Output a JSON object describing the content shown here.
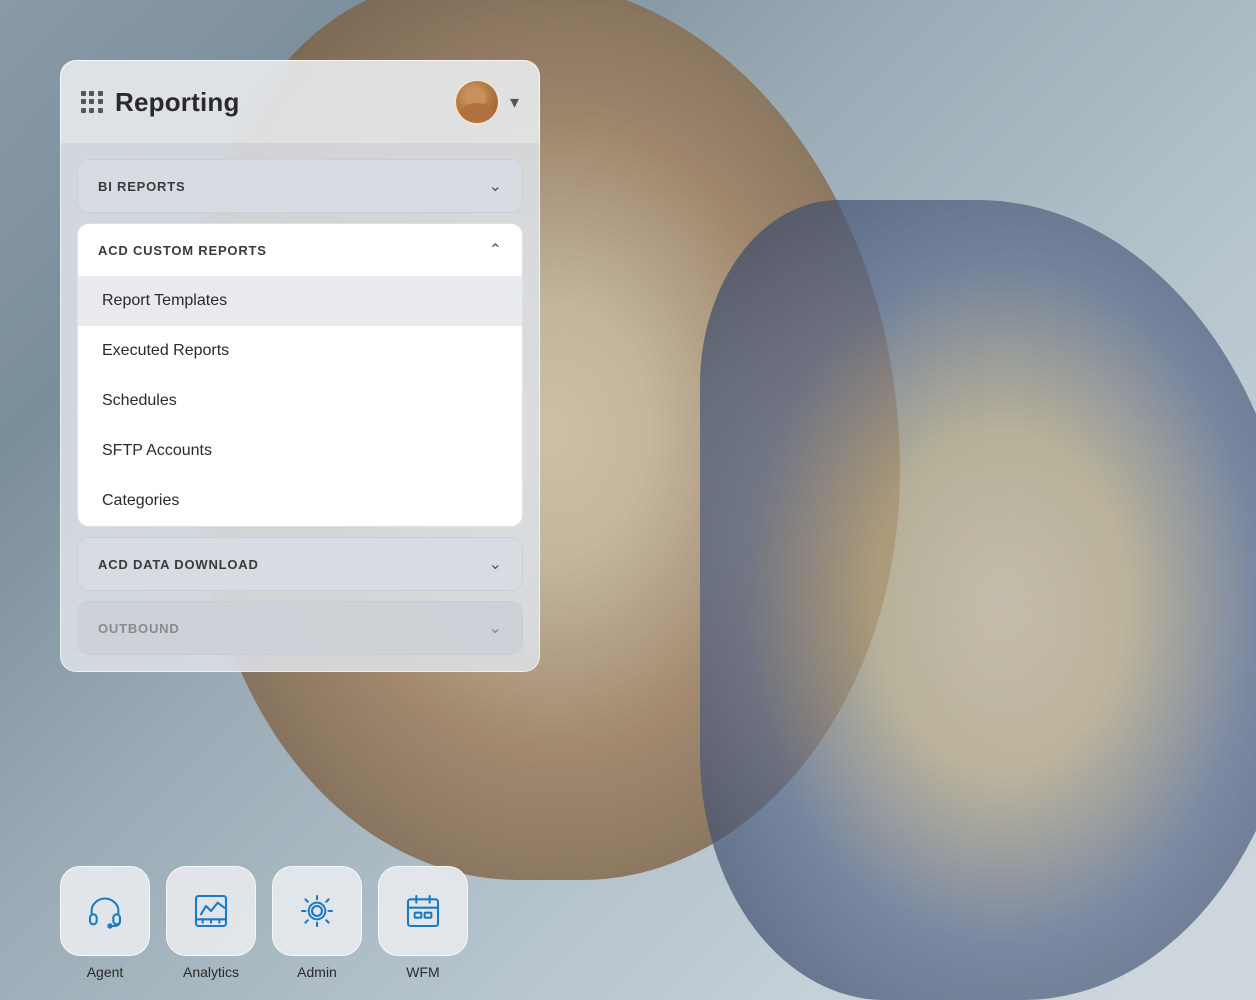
{
  "header": {
    "title": "Reporting",
    "chevron": "▾",
    "avatar_alt": "User avatar"
  },
  "menu": {
    "bi_reports": {
      "label": "BI REPORTS",
      "expanded": false,
      "chevron_collapsed": "⌄"
    },
    "acd_custom_reports": {
      "label": "ACD CUSTOM REPORTS",
      "expanded": true,
      "chevron_expanded": "⌃",
      "items": [
        {
          "label": "Report Templates",
          "active": true
        },
        {
          "label": "Executed Reports",
          "active": false
        },
        {
          "label": "Schedules",
          "active": false
        },
        {
          "label": "SFTP Accounts",
          "active": false
        },
        {
          "label": "Categories",
          "active": false
        }
      ]
    },
    "acd_data_download": {
      "label": "ACD DATA DOWNLOAD",
      "expanded": false,
      "chevron_collapsed": "⌄"
    },
    "outbound": {
      "label": "OUTBOUND",
      "expanded": false,
      "chevron_collapsed": "⌄",
      "disabled": true
    }
  },
  "bottom_nav": {
    "items": [
      {
        "id": "agent",
        "label": "Agent",
        "icon": "headset-icon"
      },
      {
        "id": "analytics",
        "label": "Analytics",
        "icon": "analytics-icon"
      },
      {
        "id": "admin",
        "label": "Admin",
        "icon": "gear-icon"
      },
      {
        "id": "wfm",
        "label": "WFM",
        "icon": "calendar-icon"
      }
    ]
  }
}
